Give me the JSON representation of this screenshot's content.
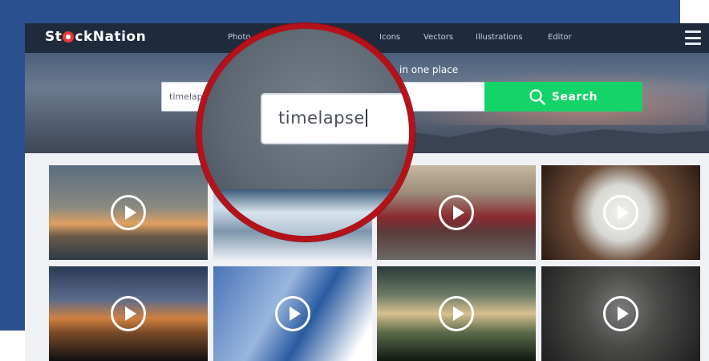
{
  "app": {
    "brand": "StockNation"
  },
  "nav": {
    "links": [
      {
        "label": "Photo"
      },
      {
        "label": "Icons"
      },
      {
        "label": "Vectors"
      },
      {
        "label": "Illustrations"
      },
      {
        "label": "Editor"
      }
    ]
  },
  "hero": {
    "title": "in one place"
  },
  "search": {
    "value": "timelap",
    "zoomed_value": "timelapse",
    "button_label": "Search"
  },
  "colors": {
    "accent": "#14d469",
    "navbar": "#1f2b3d",
    "magnifier_ring": "#b5111a",
    "background": "#2b5090"
  },
  "results": [
    {
      "kind": "video",
      "icon": "play-icon"
    },
    {
      "kind": "video",
      "icon": "play-icon"
    },
    {
      "kind": "video",
      "icon": "play-icon"
    },
    {
      "kind": "video",
      "icon": "play-icon"
    },
    {
      "kind": "video",
      "icon": "play-icon"
    },
    {
      "kind": "video",
      "icon": "play-icon"
    },
    {
      "kind": "video",
      "icon": "play-icon"
    },
    {
      "kind": "video",
      "icon": "play-icon"
    }
  ]
}
